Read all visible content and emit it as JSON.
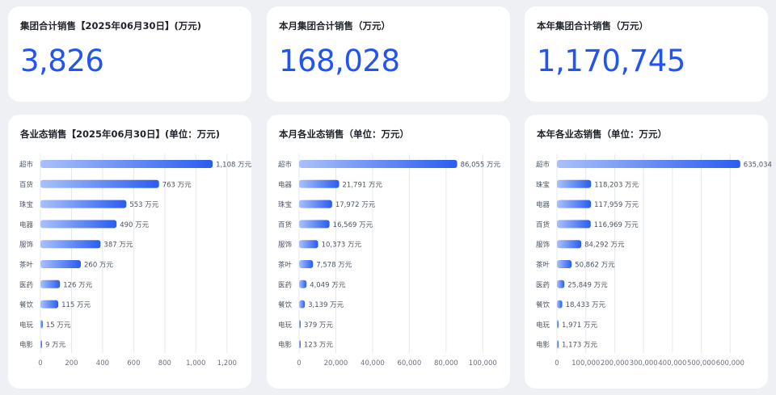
{
  "kpis": [
    {
      "title": "集团合计销售【2025年06月30日】(万元)",
      "value": "3,826"
    },
    {
      "title": "本月集团合计销售（万元）",
      "value": "168,028"
    },
    {
      "title": "本年集团合计销售（万元）",
      "value": "1,170,745"
    }
  ],
  "colors": {
    "bar_start": "#a9c1fb",
    "bar_end": "#2a5df0",
    "kpi_value": "#2255f0",
    "grid": "#e6e8ec"
  },
  "chart_data": [
    {
      "type": "bar",
      "orientation": "horizontal",
      "title": "各业态销售【2025年06月30日】(单位：万元)",
      "unit": "万元",
      "categories": [
        "超市",
        "百货",
        "珠宝",
        "电器",
        "服饰",
        "茶叶",
        "医药",
        "餐饮",
        "电玩",
        "电影"
      ],
      "values": [
        1108,
        763,
        553,
        490,
        387,
        260,
        126,
        115,
        15,
        9
      ],
      "value_labels": [
        "1,108 万元",
        "763 万元",
        "553 万元",
        "490 万元",
        "387 万元",
        "260 万元",
        "126 万元",
        "115 万元",
        "15 万元",
        "9 万元"
      ],
      "xticks": [
        0,
        200,
        400,
        600,
        800,
        1000,
        1200
      ],
      "xtick_labels": [
        "0",
        "200",
        "400",
        "600",
        "800",
        "1,000",
        "1,200"
      ],
      "xlim": [
        0,
        1300
      ],
      "grid": true
    },
    {
      "type": "bar",
      "orientation": "horizontal",
      "title": "本月各业态销售（单位：万元）",
      "unit": "万元",
      "categories": [
        "超市",
        "电器",
        "珠宝",
        "百货",
        "服饰",
        "茶叶",
        "医药",
        "餐饮",
        "电玩",
        "电影"
      ],
      "values": [
        86055,
        21791,
        17972,
        16569,
        10373,
        7578,
        4049,
        3139,
        379,
        123
      ],
      "value_labels": [
        "86,055 万元",
        "21,791 万元",
        "17,972 万元",
        "16,569 万元",
        "10,373 万元",
        "7,578 万元",
        "4,049 万元",
        "3,139 万元",
        "379 万元",
        "123 万元"
      ],
      "xticks": [
        0,
        20000,
        40000,
        60000,
        80000,
        100000
      ],
      "xtick_labels": [
        "0",
        "20,000",
        "40,000",
        "60,000",
        "80,000",
        "100,000"
      ],
      "xlim": [
        0,
        110000
      ],
      "grid": true
    },
    {
      "type": "bar",
      "orientation": "horizontal",
      "title": "本年各业态销售（单位：万元）",
      "unit": "万元",
      "categories": [
        "超市",
        "珠宝",
        "电器",
        "百货",
        "服饰",
        "茶叶",
        "医药",
        "餐饮",
        "电玩",
        "电影"
      ],
      "values": [
        635034,
        118203,
        117959,
        116969,
        84292,
        50862,
        25849,
        18433,
        1971,
        1173
      ],
      "value_labels": [
        "635,034",
        "118,203 万元",
        "117,959 万元",
        "116,969 万元",
        "84,292 万元",
        "50,862 万元",
        "25,849 万元",
        "18,433 万元",
        "1,971 万元",
        "1,173 万元"
      ],
      "xticks": [
        0,
        100000,
        200000,
        300000,
        400000,
        500000,
        600000
      ],
      "xtick_labels": [
        "0",
        "100,000",
        "200,000",
        "300,000",
        "400,000",
        "500,000",
        "600,000"
      ],
      "xlim": [
        0,
        700000
      ],
      "grid": true
    }
  ]
}
